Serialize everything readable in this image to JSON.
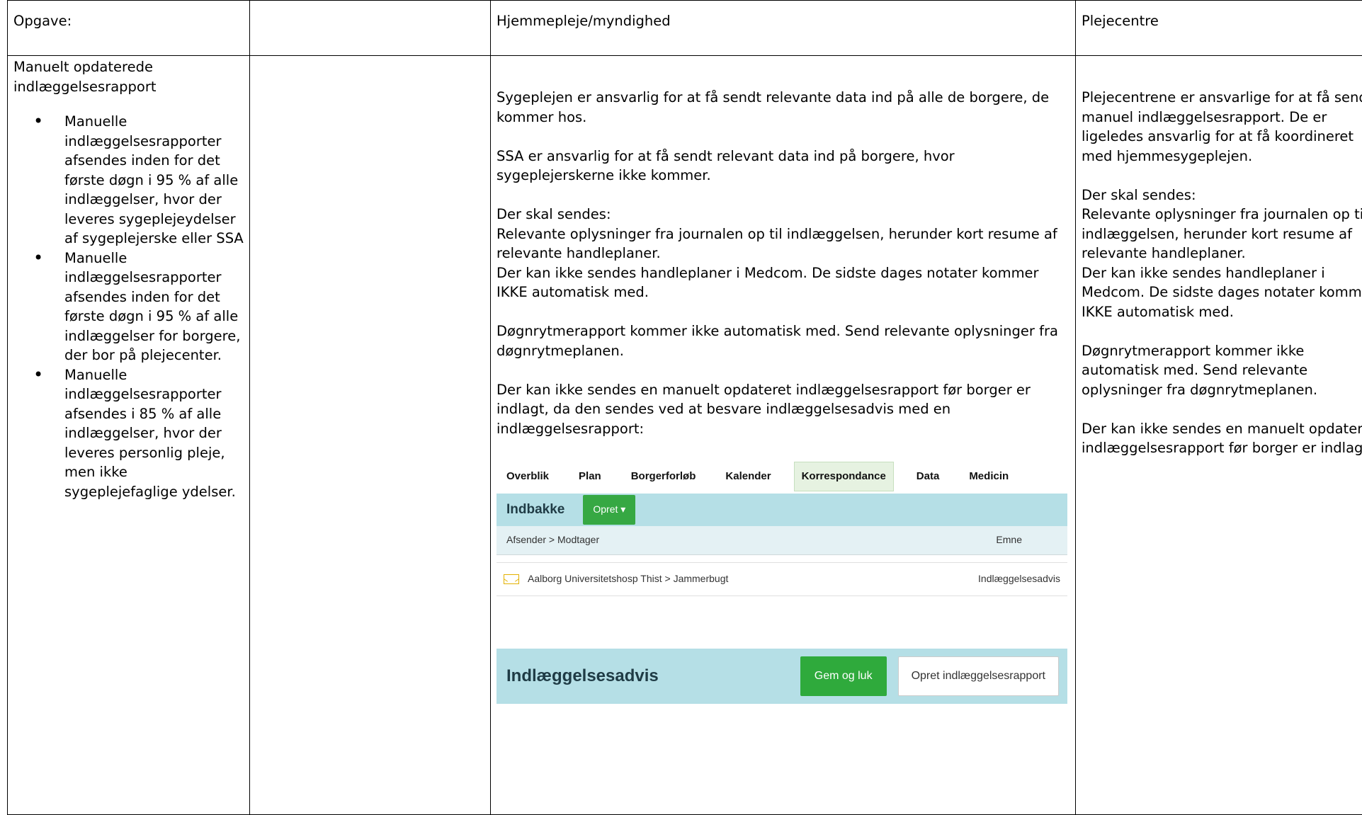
{
  "header": {
    "col1": "Opgave:",
    "col2": "",
    "col3": "Hjemmepleje/myndighed",
    "col4": "Plejecentre"
  },
  "col1": {
    "title_line1": "Manuelt opdaterede",
    "title_line2": "indlæggelsesrapport",
    "bullets": [
      " Manuelle indlæggelsesrapporter afsendes inden for det første døgn i 95 % af alle indlæggelser, hvor der leveres sygeplejeydelser af sygeplejerske eller SSA",
      "Manuelle indlæggelsesrapporter afsendes inden for det første døgn i 95 % af alle indlæggelser for borgere, der bor på plejecenter.",
      "Manuelle indlæggelsesrapporter afsendes i 85 % af alle indlæggelser, hvor der leveres personlig pleje, men ikke sygeplejefaglige ydelser."
    ]
  },
  "col3": {
    "p1": "Sygeplejen er ansvarlig for at få sendt relevante data ind på alle de borgere, de kommer hos.",
    "p2": "SSA er ansvarlig for at få sendt relevant data ind på borgere, hvor sygeplejerskerne ikke kommer.",
    "p3_head": "Der skal sendes:",
    "p3_a": "Relevante oplysninger fra journalen op til indlæggelsen, herunder kort resume af relevante handleplaner.",
    "p3_b": "Der kan ikke sendes handleplaner i Medcom. De sidste dages notater kommer IKKE automatisk med.",
    "p4": "Døgnrytmerapport kommer ikke automatisk med. Send relevante oplysninger fra døgnrytmeplanen.",
    "p5": "Der kan ikke sendes en manuelt opdateret indlæggelsesrapport før borger er indlagt, da den sendes ved at besvare indlæggelsesadvis med en indlæggelsesrapport:"
  },
  "screenshot": {
    "tabs": [
      "Overblik",
      "Plan",
      "Borgerforløb",
      "Kalender",
      "Korrespondance",
      "Data",
      "Medicin"
    ],
    "active_tab": "Korrespondance",
    "inbox_title": "Indbakke",
    "opret_label": "Opret ▾",
    "col_sender": "Afsender > Modtager",
    "col_subject": "Emne",
    "message_from": "Aalborg Universitetshosp Thist > Jammerbugt",
    "message_subject": "Indlæggelsesadvis",
    "advis_title": "Indlæggelsesadvis",
    "gem_label": "Gem og luk",
    "opret_rapport_label": "Opret indlæggelsesrapport",
    "accent_color": "#36a843",
    "bar_color": "#b5dfe6"
  },
  "col4": {
    "p1": "Plejecentrene er ansvarlige for at få sendt manuel indlæggelsesrapport. De er ligeledes ansvarlig for at få koordineret med hjemmesygeplejen.",
    "p2_head": "Der skal sendes:",
    "p2_a": "Relevante oplysninger fra journalen op til indlæggelsen, herunder kort resume af relevante handleplaner.",
    "p2_b": "Der kan ikke sendes handleplaner i Medcom. De sidste dages notater kommer IKKE automatisk med.",
    "p3": "Døgnrytmerapport kommer ikke automatisk med. Send relevante oplysninger fra døgnrytmeplanen.",
    "p4": "Der kan ikke sendes en manuelt opdateret indlæggelsesrapport før borger er indlagt."
  }
}
